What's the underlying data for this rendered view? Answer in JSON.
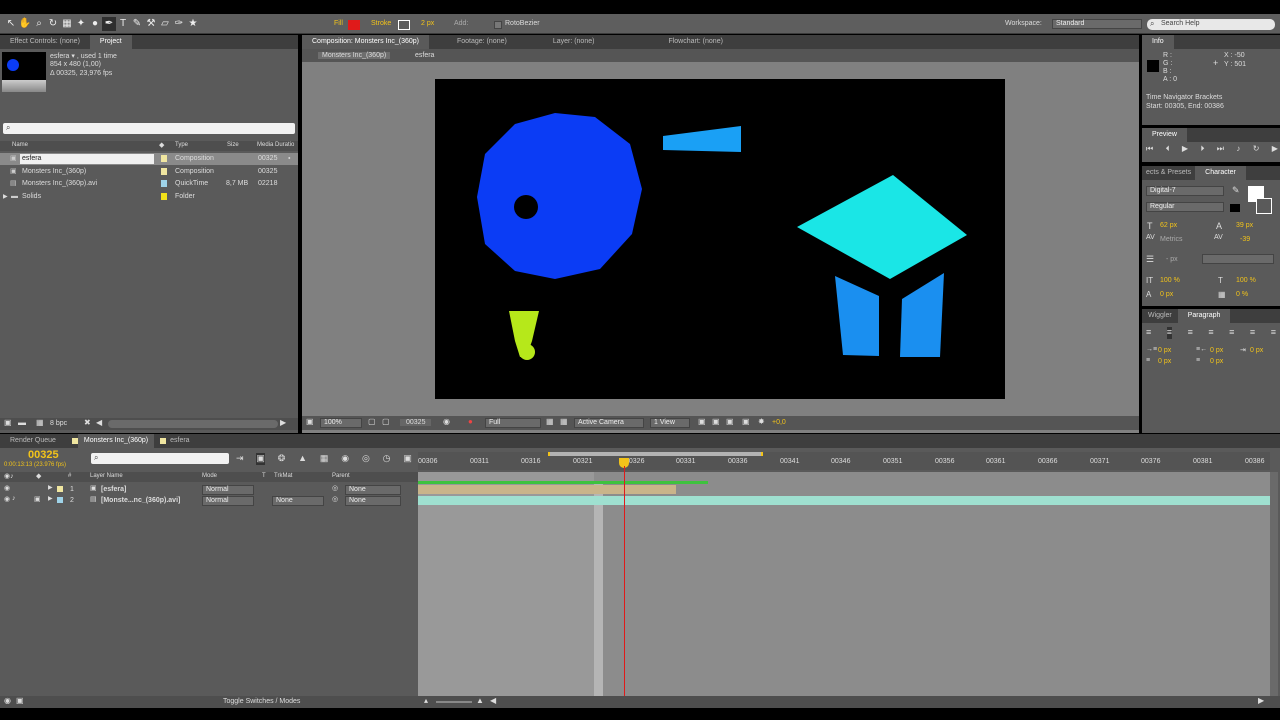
{
  "toolbar": {
    "fill_label": "Fill",
    "stroke_label": "Stroke",
    "stroke_width": "2 px",
    "add_label": "Add:",
    "rotobezier_label": "RotoBezier",
    "workspace_label": "Workspace:",
    "workspace_value": "Standard",
    "search_placeholder": "Search Help"
  },
  "project": {
    "tab_effect_controls": "Effect Controls: (none)",
    "tab_project": "Project",
    "preview_name": "esfera ▾ , used 1 time",
    "preview_dims": "854 x 480 (1,00)",
    "preview_duration": "Δ 00325, 23,976 fps",
    "columns": [
      "Name",
      "Type",
      "Size",
      "Media Duratio"
    ],
    "items": [
      {
        "name": "esfera",
        "type": "Composition",
        "size": "",
        "duration": "00325"
      },
      {
        "name": "Monsters Inc_(360p)",
        "type": "Composition",
        "size": "",
        "duration": "00325"
      },
      {
        "name": "Monsters Inc_(360p).avi",
        "type": "QuickTime",
        "size": "8,7 MB",
        "duration": "02218"
      },
      {
        "name": "Solids",
        "type": "Folder",
        "size": "",
        "duration": ""
      }
    ],
    "bpc": "8 bpc"
  },
  "viewer": {
    "tab_composition": "Composition: Monsters Inc_(360p)",
    "tab_footage": "Footage: (none)",
    "tab_layer": "Layer: (none)",
    "tab_flowchart": "Flowchart: (none)",
    "crumb_1": "Monsters Inc_(360p)",
    "crumb_2": "esfera",
    "zoom": "100%",
    "timecode": "00325",
    "resolution": "Full",
    "camera": "Active Camera",
    "views": "1 View",
    "exposure": "+0,0"
  },
  "info": {
    "tab": "Info",
    "r": "R :",
    "g": "G :",
    "b": "B :",
    "a": "A : 0",
    "x": "X : -50",
    "y": "Y : 501",
    "bracket_title": "Time Navigator Brackets",
    "bracket_range": "Start: 00305, End: 00386"
  },
  "preview": {
    "tab": "Preview"
  },
  "character": {
    "tab_effects": "ects & Presets",
    "tab_character": "Character",
    "font": "Digital-7",
    "style": "Regular",
    "size": "62 px",
    "leading": "39 px",
    "kerning": "Metrics",
    "tracking": "-39",
    "stroke_px": "- px",
    "vscale": "100 %",
    "hscale": "100 %",
    "baseline": "0 px",
    "tsume": "0 %"
  },
  "paragraph": {
    "tab_wiggler": "Wiggler",
    "tab_paragraph": "Paragraph",
    "indent_left": "0 px",
    "indent_right": "0 px",
    "indent_first": "0 px",
    "space_before": "0 px",
    "space_after": "0 px"
  },
  "timeline": {
    "tab_render": "Render Queue",
    "tab_comp": "Monsters Inc_(360p)",
    "tab_esfera": "esfera",
    "current_time": "00325",
    "current_time_sub": "0:00:13:13 (23.976 fps)",
    "col_layer_name": "Layer Name",
    "col_mode": "Mode",
    "col_t": "T",
    "col_trkmat": "TrkMat",
    "col_parent": "Parent",
    "ticks": [
      "00306",
      "00311",
      "00316",
      "00321",
      "00326",
      "00331",
      "00336",
      "00341",
      "00346",
      "00351",
      "00356",
      "00361",
      "00366",
      "00371",
      "00376",
      "00381",
      "00386"
    ],
    "layers": [
      {
        "num": "1",
        "name": "[esfera]",
        "mode": "Normal",
        "trkmat": "",
        "parent": "None"
      },
      {
        "num": "2",
        "name": "[Monste...nc_(360p).avi]",
        "mode": "Normal",
        "trkmat": "None",
        "parent": "None"
      }
    ],
    "toggle_label": "Toggle Switches / Modes"
  },
  "colors": {
    "bg_panel": "#5a5a5a",
    "canvas": "#000000",
    "circle": "#0b3cf5",
    "cyan_shape": "#1ae6e6",
    "blue_shape": "#1aa0f5",
    "yellow_shape": "#b6e81a",
    "timecode": "#f2c31a"
  }
}
